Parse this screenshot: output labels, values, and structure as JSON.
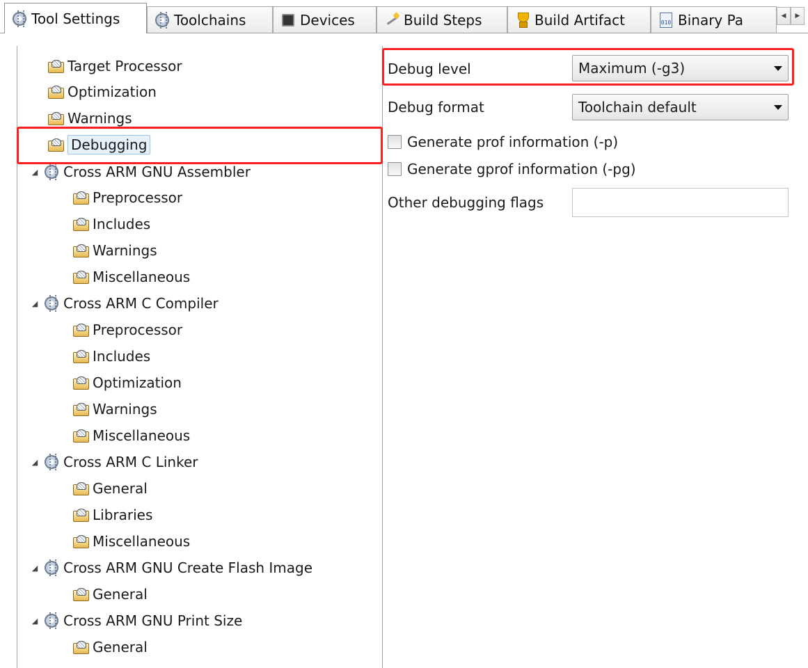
{
  "tabs": [
    {
      "label": "Tool Settings",
      "icon": "gear-icon",
      "active": true
    },
    {
      "label": "Toolchains",
      "icon": "gear-icon",
      "active": false
    },
    {
      "label": "Devices",
      "icon": "chip-icon",
      "active": false
    },
    {
      "label": "Build Steps",
      "icon": "wand-icon",
      "active": false
    },
    {
      "label": "Build Artifact",
      "icon": "trophy-icon",
      "active": false
    },
    {
      "label": "Binary Pa",
      "icon": "binary-file-icon",
      "active": false
    }
  ],
  "tab_scroll": {
    "left": "◀",
    "right": "▶"
  },
  "tree": [
    {
      "label": "Target Processor"
    },
    {
      "label": "Optimization"
    },
    {
      "label": "Warnings"
    },
    {
      "label": "Debugging",
      "selected": true
    },
    {
      "label": "Cross ARM GNU Assembler",
      "expanded": true,
      "twisty": "◢"
    },
    {
      "label": "Preprocessor"
    },
    {
      "label": "Includes"
    },
    {
      "label": "Warnings"
    },
    {
      "label": "Miscellaneous"
    },
    {
      "label": "Cross ARM C Compiler",
      "expanded": true,
      "twisty": "◢"
    },
    {
      "label": "Preprocessor"
    },
    {
      "label": "Includes"
    },
    {
      "label": "Optimization"
    },
    {
      "label": "Warnings"
    },
    {
      "label": "Miscellaneous"
    },
    {
      "label": "Cross ARM C Linker",
      "expanded": true,
      "twisty": "◢"
    },
    {
      "label": "General"
    },
    {
      "label": "Libraries"
    },
    {
      "label": "Miscellaneous"
    },
    {
      "label": "Cross ARM GNU Create Flash Image",
      "expanded": true,
      "twisty": "◢"
    },
    {
      "label": "General"
    },
    {
      "label": "Cross ARM GNU Print Size",
      "expanded": true,
      "twisty": "◢"
    },
    {
      "label": "General"
    }
  ],
  "settings": {
    "debug_level_label": "Debug level",
    "debug_level_value": "Maximum (-g3)",
    "debug_format_label": "Debug format",
    "debug_format_value": "Toolchain default",
    "prof_label": "Generate prof information (-p)",
    "prof_checked": false,
    "gprof_label": "Generate gprof information (-pg)",
    "gprof_checked": false,
    "other_flags_label": "Other debugging flags",
    "other_flags_value": ""
  },
  "colors": {
    "highlight": "#ff1f1f",
    "selection": "#e5f1fb"
  }
}
